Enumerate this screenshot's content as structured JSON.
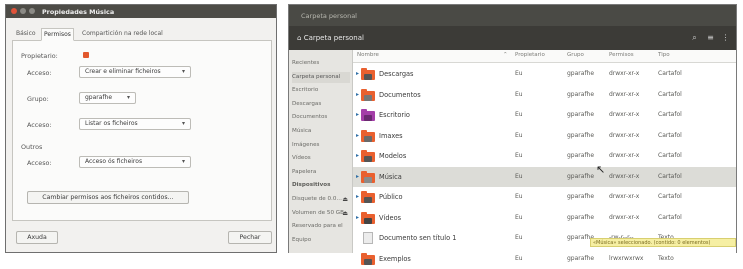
{
  "file_manager": {
    "window_title": "Carpeta personal",
    "location": "Carpeta personal",
    "sidebar": [
      {
        "label": "Recientes"
      },
      {
        "label": "Carpeta personal",
        "selected": true
      },
      {
        "label": "Escritorio"
      },
      {
        "label": "Descargas"
      },
      {
        "label": "Documentos"
      },
      {
        "label": "Música"
      },
      {
        "label": "Imágenes"
      },
      {
        "label": "Vídeos"
      },
      {
        "label": "Papelera"
      },
      {
        "label": "Dispositivos",
        "header": true
      },
      {
        "label": "Disquete de 0.0…",
        "eject": "⏏"
      },
      {
        "label": "Volumen de 50 GB",
        "eject": "⏏"
      },
      {
        "label": "Reservado para el"
      },
      {
        "label": "Equipo"
      }
    ],
    "columns": {
      "name": "Nombre",
      "owner": "Propietario",
      "group": "Grupo",
      "permissions": "Permisos",
      "type": "Tipo"
    },
    "rows": [
      {
        "name": "Descargas",
        "owner": "Eu",
        "group": "gparafhe",
        "permissions": "drwxr-xr-x",
        "type": "Cartafol",
        "icon_color": "#e9602f",
        "inner_color": "#555555",
        "kind": "folder",
        "expand": "▸",
        "selected": false
      },
      {
        "name": "Documentos",
        "owner": "Eu",
        "group": "gparafhe",
        "permissions": "drwxr-xr-x",
        "type": "Cartafol",
        "icon_color": "#e9602f",
        "inner_color": "#777777",
        "kind": "folder",
        "expand": "▸",
        "selected": false
      },
      {
        "name": "Escritorio",
        "owner": "Eu",
        "group": "gparafhe",
        "permissions": "drwxr-xr-x",
        "type": "Cartafol",
        "icon_color": "#a43ea8",
        "inner_color": "#6a2a70",
        "kind": "folder",
        "expand": "▸",
        "selected": false
      },
      {
        "name": "Imaxes",
        "owner": "Eu",
        "group": "gparafhe",
        "permissions": "drwxr-xr-x",
        "type": "Cartafol",
        "icon_color": "#e9602f",
        "inner_color": "#6a6a6a",
        "kind": "folder",
        "expand": "▸",
        "selected": false
      },
      {
        "name": "Modelos",
        "owner": "Eu",
        "group": "gparafhe",
        "permissions": "drwxr-xr-x",
        "type": "Cartafol",
        "icon_color": "#e9602f",
        "inner_color": "#555555",
        "kind": "folder",
        "expand": "▸",
        "selected": false
      },
      {
        "name": "Música",
        "owner": "Eu",
        "group": "gparafhe",
        "permissions": "drwxr-xr-x",
        "type": "Cartafol",
        "icon_color": "#e9602f",
        "inner_color": "#8a8a8a",
        "kind": "folder",
        "expand": "▸",
        "selected": true
      },
      {
        "name": "Público",
        "owner": "Eu",
        "group": "gparafhe",
        "permissions": "drwxr-xr-x",
        "type": "Cartafol",
        "icon_color": "#e9602f",
        "inner_color": "#555555",
        "kind": "folder",
        "expand": "▸",
        "selected": false
      },
      {
        "name": "Vídeos",
        "owner": "Eu",
        "group": "gparafhe",
        "permissions": "drwxr-xr-x",
        "type": "Cartafol",
        "icon_color": "#e9602f",
        "inner_color": "#444444",
        "kind": "folder",
        "expand": "▸",
        "selected": false
      },
      {
        "name": "Documento sen título 1",
        "owner": "Eu",
        "group": "gparafhe",
        "permissions": "-rw-r--r--",
        "type": "Texto",
        "icon_color": "#ececec",
        "inner_color": "#ececec",
        "kind": "doc",
        "expand": "",
        "selected": false
      },
      {
        "name": "Exemplos",
        "owner": "Eu",
        "group": "gparafhe",
        "permissions": "lrwxrwxrwx",
        "type": "Texto",
        "icon_color": "#e9602f",
        "inner_color": "#555555",
        "kind": "folder",
        "expand": "",
        "selected": false
      }
    ],
    "status_tip": "«Música» seleccionado. (contido: 0 elementos)"
  },
  "dialog": {
    "title": "Propiedades Música",
    "tabs": [
      {
        "label": "Básico",
        "active": false
      },
      {
        "label": "Permisos",
        "active": true
      },
      {
        "label": "Compartición na rede local",
        "active": false
      }
    ],
    "owner_label": "Propietario:",
    "owner_access_label": "Acceso:",
    "owner_access_value": "Crear e eliminar ficheiros",
    "group_label": "Grupo:",
    "group_value": "gparafhe",
    "group_access_label": "Acceso:",
    "group_access_value": "Listar os ficheiros",
    "others_label": "Outros",
    "others_access_label": "Acceso:",
    "others_access_value": "Acceso ós ficheiros",
    "change_files_button": "Cambiar permisos aos ficheiros contidos…",
    "help_button": "Axuda",
    "close_button": "Pechar",
    "colors": {
      "lock": "#e2582d",
      "close_dot": "#e0533a",
      "other_dots": "#8b8a85"
    }
  }
}
